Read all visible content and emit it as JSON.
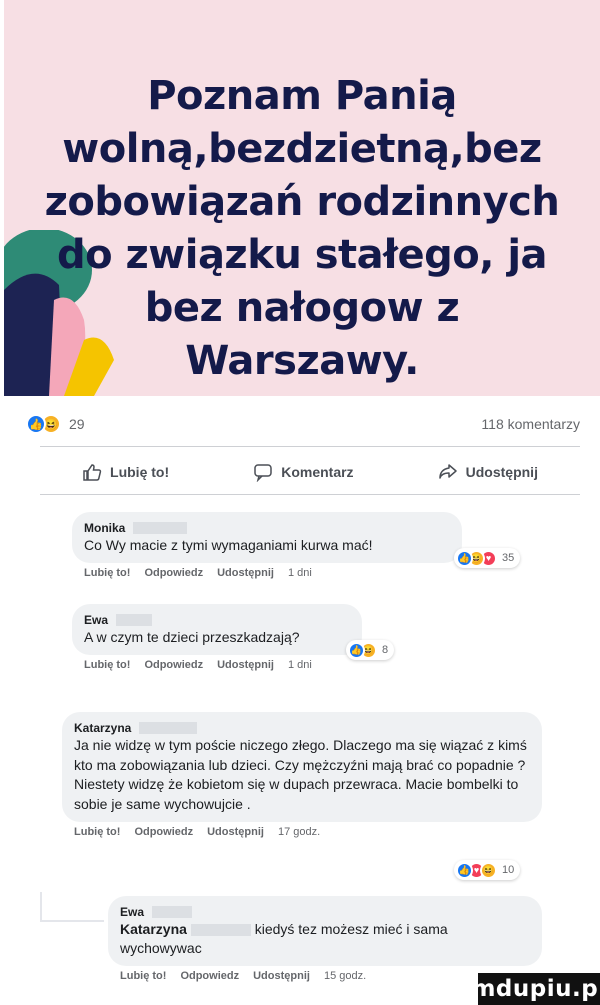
{
  "post": {
    "banner_text": "Poznam Panią wolną,bezdzietną,bez zobowiązań rodzinnych do związku stałego, ja bez nałogow z Warszawy.",
    "banner_bg": "#f7dfe4",
    "banner_text_color": "#141a4a"
  },
  "summary": {
    "reaction_icons": [
      "like-icon",
      "haha-icon"
    ],
    "reaction_count": "29",
    "comments_count": "118 komentarzy"
  },
  "actions": {
    "like": "Lubię to!",
    "comment": "Komentarz",
    "share": "Udostępnij"
  },
  "comments": [
    {
      "author": "Monika",
      "text": "Co Wy macie z tymi wymaganiami kurwa mać!",
      "like": "Lubię to!",
      "reply": "Odpowiedz",
      "share": "Udostępnij",
      "time": "1 dni",
      "reactions": [
        "like-icon",
        "haha-icon",
        "love-icon"
      ],
      "reaction_count": "35"
    },
    {
      "author": "Ewa",
      "text": "A w czym te dzieci przeszkadzają?",
      "like": "Lubię to!",
      "reply": "Odpowiedz",
      "share": "Udostępnij",
      "time": "1 dni",
      "reactions": [
        "like-icon",
        "haha-icon"
      ],
      "reaction_count": "8"
    },
    {
      "author": "Katarzyna",
      "text": "Ja nie widzę w tym poście niczego złego. Dlaczego ma się wiązać z kimś kto ma zobowiązania lub dzieci. Czy mężczyźni mają brać co popadnie ? Niestety widzę że kobietom się w dupach przewraca. Macie bombelki to sobie je same wychowujcie .",
      "like": "Lubię to!",
      "reply": "Odpowiedz",
      "share": "Udostępnij",
      "time": "17 godz.",
      "reactions": [
        "like-icon",
        "love-icon",
        "haha-icon"
      ],
      "reaction_count": "10"
    },
    {
      "author": "Ewa",
      "mention": "Katarzyna",
      "text": "kiedyś tez możesz mieć i sama wychowywac",
      "like": "Lubię to!",
      "reply": "Odpowiedz",
      "share": "Udostępnij",
      "time": "15 godz."
    }
  ],
  "watermark": "mdupiu.pl",
  "colors": {
    "like_blue": "#1877f2",
    "haha_yellow": "#f7b125",
    "love_red": "#f33e58",
    "bubble_bg": "#eff1f3"
  }
}
